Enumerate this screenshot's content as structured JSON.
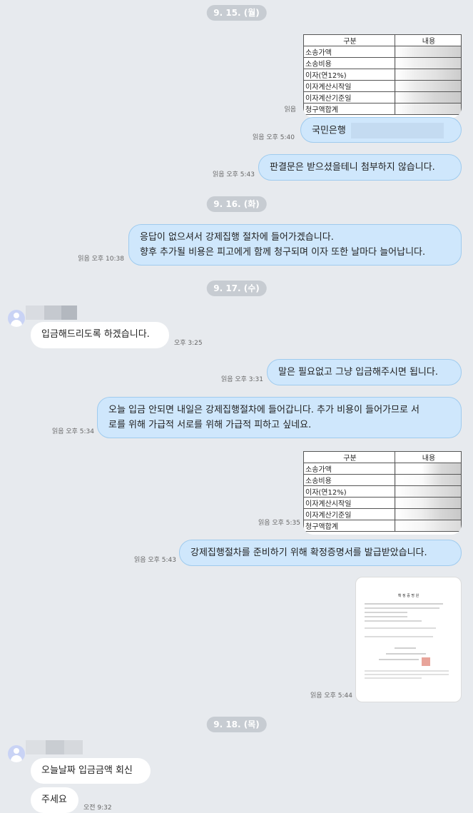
{
  "dates": {
    "d1": "9. 15. (월)",
    "d2": "9. 16. (화)",
    "d3": "9. 17. (수)",
    "d4": "9. 18. (목)"
  },
  "table": {
    "header_col1": "구분",
    "header_col2": "내용",
    "rows": [
      "소송가액",
      "소송비용",
      "이자(연12%)",
      "이자계산시작일",
      "이자계산기준일",
      "청구액합계"
    ]
  },
  "messages": {
    "m1_meta": "읽음",
    "m2_text": "국민은행",
    "m2_meta": "읽음 오후 5:40",
    "m3_text": "판결문은 받으셨을테니 첨부하지 않습니다.",
    "m3_meta": "읽음 오후 5:43",
    "m4_line1": "응답이 없으셔서 강제집행 절차에 들어가겠습니다.",
    "m4_line2": "향후 추가될 비용은 피고에게 함께 청구되며 이자 또한 날마다 늘어납니다.",
    "m4_meta": "읽음 오후 10:38",
    "m5_text": "입금해드리도록 하겠습니다.",
    "m5_meta": "오후 3:25",
    "m6_text": "말은 필요없고 그냥 입금해주시면 됩니다.",
    "m6_meta": "읽음 오후 3:31",
    "m7_line1": "오늘 입금 안되면 내일은 강제집행절차에 들어갑니다. 추가 비용이 들어가므로 서",
    "m7_line2": "로를 위해 가급적 서로를 위해 가급적 피하고 싶네요.",
    "m7_meta": "읽음 오후 5:34",
    "m8_meta": "읽음 오후 5:35",
    "m9_text": "강제집행절차를 준비하기 위해 확정증명서를 발급받았습니다.",
    "m9_meta": "읽음 오후 5:43",
    "m10_meta": "읽음 오후 5:44",
    "m11_text": "오늘날짜 입금금액 회신",
    "m12_text": "주세요",
    "m12_meta": "오전 9:32"
  },
  "certificate": {
    "title": "확 정 증 명 원"
  },
  "colors": {
    "outgoing_bubble": "#cfe7fc",
    "incoming_bubble": "#ffffff",
    "background": "#e7eaee",
    "date_pill": "#c7ccd2"
  }
}
